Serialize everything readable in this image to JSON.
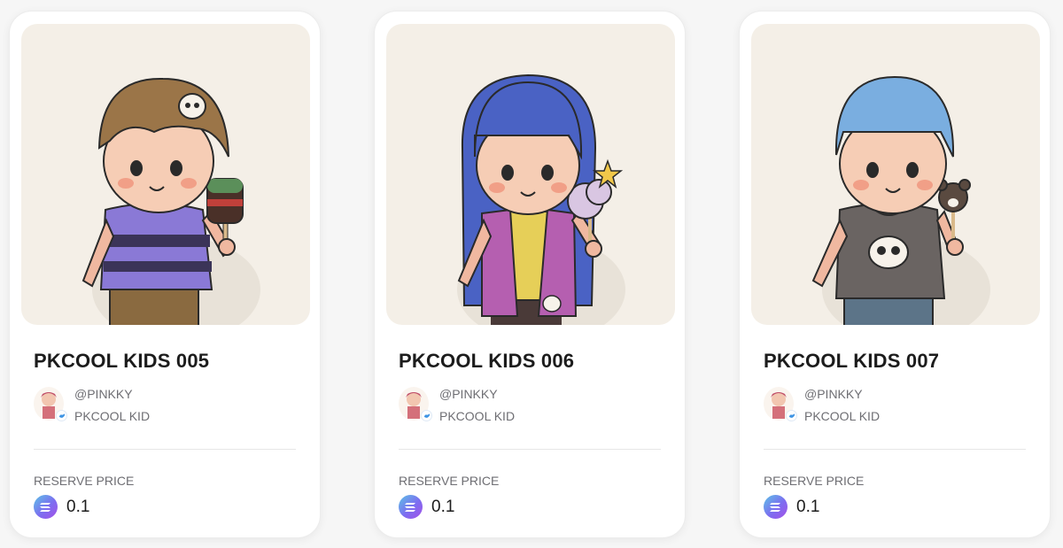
{
  "cards": [
    {
      "title": "PKCOOL KIDS 005",
      "creator_handle": "@PINKKY",
      "collection": "PKCOOL KID",
      "price_label": "RESERVE PRICE",
      "price": "0.1",
      "artwork": "kid-brown-hair-purple-striped-shirt-chocolate-popsicle",
      "colors": {
        "hair": "#9b7548",
        "shirt": "#8a79d6",
        "stripe": "#3b3458",
        "pants": "#8a6a40",
        "treat_top": "#5b8f5a",
        "treat_mid": "#c0403a",
        "treat_bottom": "#4a3028"
      }
    },
    {
      "title": "PKCOOL KIDS 006",
      "creator_handle": "@PINKKY",
      "collection": "PKCOOL KID",
      "price_label": "RESERVE PRICE",
      "price": "0.1",
      "artwork": "kid-long-blue-hair-pink-jacket-cotton-candy",
      "colors": {
        "hair": "#4a62c4",
        "shirt": "#e6cf58",
        "jacket": "#b55fb0",
        "pants": "#4a3a38",
        "treat": "#d9c6e2",
        "star": "#f2c84a"
      }
    },
    {
      "title": "PKCOOL KIDS 007",
      "creator_handle": "@PINKKY",
      "collection": "PKCOOL KID",
      "price_label": "RESERVE PRICE",
      "price": "0.1",
      "artwork": "kid-light-blue-hair-grey-skull-hoodie-bear-popsicle",
      "colors": {
        "hair": "#7aaee0",
        "shirt": "#6a6462",
        "pants": "#5c7488",
        "treat": "#5a4a40"
      }
    }
  ]
}
